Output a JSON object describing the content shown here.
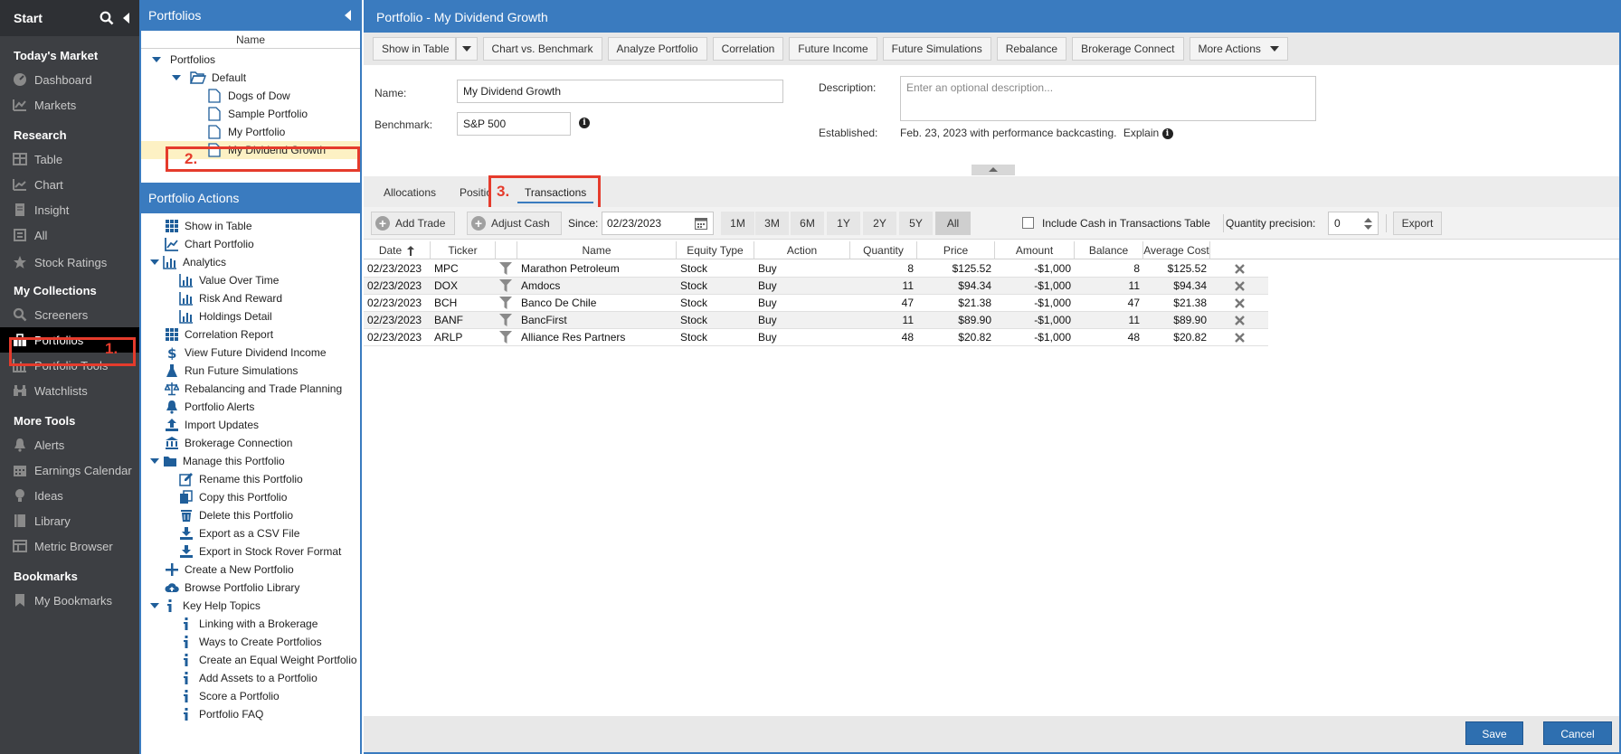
{
  "leftnav": {
    "start": "Start",
    "sections": {
      "todays_market": "Today's Market",
      "research": "Research",
      "my_collections": "My Collections",
      "more_tools": "More Tools",
      "bookmarks": "Bookmarks"
    },
    "items": {
      "dashboard": "Dashboard",
      "markets": "Markets",
      "table": "Table",
      "chart": "Chart",
      "insight": "Insight",
      "all": "All",
      "stock_ratings": "Stock Ratings",
      "screeners": "Screeners",
      "portfolios": "Portfolios",
      "portfolio_tools": "Portfolio Tools",
      "watchlists": "Watchlists",
      "alerts": "Alerts",
      "earnings_calendar": "Earnings Calendar",
      "ideas": "Ideas",
      "library": "Library",
      "metric_browser": "Metric Browser",
      "my_bookmarks": "My Bookmarks"
    },
    "annotation": "1."
  },
  "portfolios_panel": {
    "title": "Portfolios",
    "col_header": "Name",
    "root": "Portfolios",
    "folder": "Default",
    "items": [
      "Dogs of Dow",
      "Sample Portfolio",
      "My Portfolio",
      "My Dividend Growth"
    ],
    "annotation": "2."
  },
  "actions_panel": {
    "title": "Portfolio Actions",
    "items": {
      "show_in_table": "Show in Table",
      "chart_portfolio": "Chart Portfolio",
      "analytics": "Analytics",
      "value_over_time": "Value Over Time",
      "risk_and_reward": "Risk And Reward",
      "holdings_detail": "Holdings Detail",
      "correlation_report": "Correlation Report",
      "view_future_dividend_income": "View Future Dividend Income",
      "run_future_simulations": "Run Future Simulations",
      "rebalancing": "Rebalancing and Trade Planning",
      "portfolio_alerts": "Portfolio Alerts",
      "import_updates": "Import Updates",
      "brokerage_connection": "Brokerage Connection",
      "manage_this_portfolio": "Manage this Portfolio",
      "rename": "Rename this Portfolio",
      "copy": "Copy this Portfolio",
      "delete": "Delete this Portfolio",
      "export_csv": "Export as a CSV File",
      "export_stock_rover": "Export in Stock Rover Format",
      "create_new": "Create a New Portfolio",
      "browse_library": "Browse Portfolio Library",
      "key_help_topics": "Key Help Topics",
      "linking": "Linking with a Brokerage",
      "ways_to_create": "Ways to Create Portfolios",
      "equal_weight": "Create an Equal Weight Portfolio",
      "add_assets": "Add Assets to a Portfolio",
      "score": "Score a Portfolio",
      "faq": "Portfolio FAQ"
    }
  },
  "main": {
    "title": "Portfolio - My Dividend Growth",
    "toolbar": {
      "show_in_table": "Show in Table",
      "chart_vs_benchmark": "Chart vs. Benchmark",
      "analyze_portfolio": "Analyze Portfolio",
      "correlation": "Correlation",
      "future_income": "Future Income",
      "future_simulations": "Future Simulations",
      "rebalance": "Rebalance",
      "brokerage_connect": "Brokerage Connect",
      "more_actions": "More Actions"
    },
    "form": {
      "name_label": "Name:",
      "name_value": "My Dividend Growth",
      "benchmark_label": "Benchmark:",
      "benchmark_value": "S&P 500",
      "description_label": "Description:",
      "description_placeholder": "Enter an optional description...",
      "established_label": "Established:",
      "established_value": "Feb. 23, 2023 with performance backcasting.",
      "explain": "Explain"
    },
    "tabs": {
      "allocations": "Allocations",
      "positions": "Positions",
      "transactions": "Transactions",
      "annotation": "3."
    },
    "subbar": {
      "add_trade": "Add Trade",
      "adjust_cash": "Adjust Cash",
      "since_label": "Since:",
      "since_value": "02/23/2023",
      "ranges": [
        "1M",
        "3M",
        "6M",
        "1Y",
        "2Y",
        "5Y",
        "All"
      ],
      "active_range": "All",
      "include_cash": "Include Cash in Transactions Table",
      "qty_precision_label": "Quantity precision:",
      "qty_precision_value": "0",
      "export": "Export"
    },
    "table": {
      "columns": [
        "Date",
        "Ticker",
        "",
        "Name",
        "Equity Type",
        "Action",
        "Quantity",
        "Price",
        "Amount",
        "Balance",
        "Average Cost"
      ],
      "rows": [
        {
          "date": "02/23/2023",
          "ticker": "MPC",
          "name": "Marathon Petroleum",
          "equity_type": "Stock",
          "action": "Buy",
          "quantity": "8",
          "price": "$125.52",
          "amount": "-$1,000",
          "balance": "8",
          "avg_cost": "$125.52"
        },
        {
          "date": "02/23/2023",
          "ticker": "DOX",
          "name": "Amdocs",
          "equity_type": "Stock",
          "action": "Buy",
          "quantity": "11",
          "price": "$94.34",
          "amount": "-$1,000",
          "balance": "11",
          "avg_cost": "$94.34"
        },
        {
          "date": "02/23/2023",
          "ticker": "BCH",
          "name": "Banco De Chile",
          "equity_type": "Stock",
          "action": "Buy",
          "quantity": "47",
          "price": "$21.38",
          "amount": "-$1,000",
          "balance": "47",
          "avg_cost": "$21.38"
        },
        {
          "date": "02/23/2023",
          "ticker": "BANF",
          "name": "BancFirst",
          "equity_type": "Stock",
          "action": "Buy",
          "quantity": "11",
          "price": "$89.90",
          "amount": "-$1,000",
          "balance": "11",
          "avg_cost": "$89.90"
        },
        {
          "date": "02/23/2023",
          "ticker": "ARLP",
          "name": "Alliance Res Partners",
          "equity_type": "Stock",
          "action": "Buy",
          "quantity": "48",
          "price": "$20.82",
          "amount": "-$1,000",
          "balance": "48",
          "avg_cost": "$20.82"
        }
      ]
    },
    "footer": {
      "save": "Save",
      "cancel": "Cancel"
    }
  },
  "colors": {
    "accent": "#3a7bbf",
    "nav_bg": "#3d3f43",
    "highlight": "#e53b2c",
    "selected_row": "#fdf1c4"
  }
}
